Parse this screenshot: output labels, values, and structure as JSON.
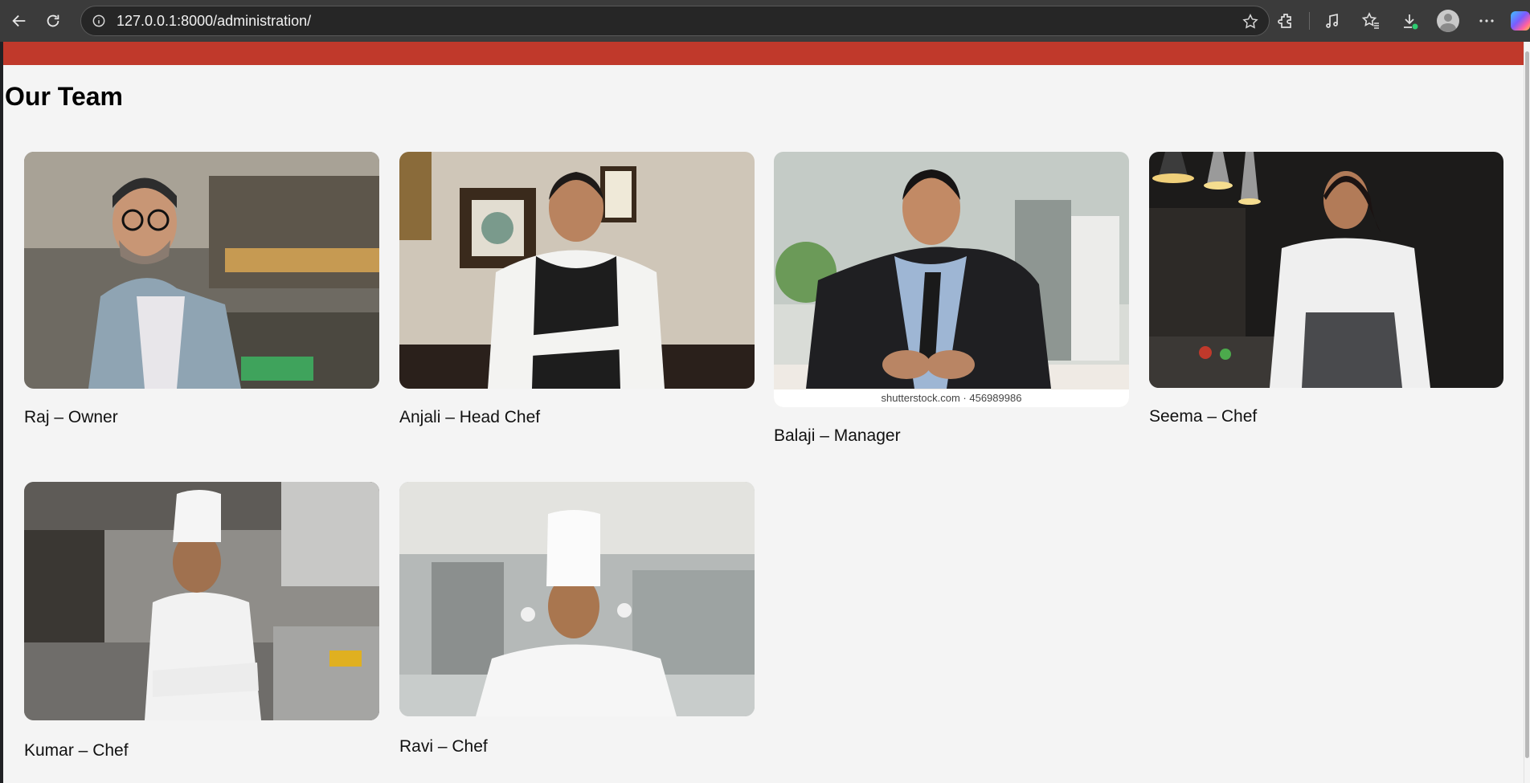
{
  "browser": {
    "url": "127.0.0.1:8000/administration/",
    "icons": [
      "back-icon",
      "reload-icon",
      "info-icon",
      "favorite-star-icon",
      "extensions-icon",
      "media-icon",
      "favorites-icon",
      "downloads-icon",
      "profile-avatar",
      "more-icon",
      "copilot-icon"
    ]
  },
  "page": {
    "title": "Our Team",
    "header_color": "#c0392b",
    "team": [
      {
        "caption": "Raj – Owner",
        "watermark": ""
      },
      {
        "caption": "Anjali – Head Chef",
        "watermark": ""
      },
      {
        "caption": "Balaji – Manager",
        "watermark": "shutterstock.com · 456989986"
      },
      {
        "caption": "Seema – Chef",
        "watermark": ""
      },
      {
        "caption": "Kumar – Chef",
        "watermark": ""
      },
      {
        "caption": "Ravi – Chef",
        "watermark": ""
      }
    ]
  }
}
